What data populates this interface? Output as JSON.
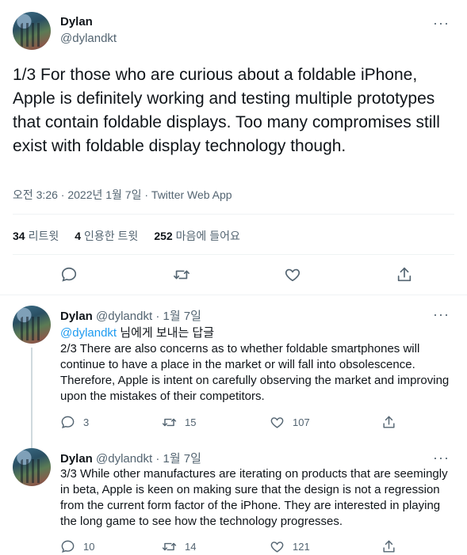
{
  "main_tweet": {
    "name": "Dylan",
    "handle": "@dylandkt",
    "text": "1/3 For those who are curious about a foldable iPhone, Apple is definitely working and testing multiple prototypes that contain foldable displays. Too many compromises still exist with foldable display technology though.",
    "meta": "오전 3:26 · 2022년 1월 7일 · Twitter Web App",
    "stats": {
      "retweets_count": "34",
      "retweets_label": "리트윗",
      "quotes_count": "4",
      "quotes_label": "인용한 트윗",
      "likes_count": "252",
      "likes_label": "마음에 들어요"
    }
  },
  "replies": [
    {
      "name": "Dylan",
      "handle": "@dylandkt",
      "date": "· 1월 7일",
      "reply_mention": "@dylandkt",
      "reply_suffix": "님에게 보내는 답글",
      "text": "2/3 There are also concerns as to whether foldable smartphones will continue to have a place in the market or will fall into obsolescence. Therefore, Apple is intent on carefully observing the market and improving upon the mistakes of their competitors.",
      "replies_count": "3",
      "retweets_count": "15",
      "likes_count": "107"
    },
    {
      "name": "Dylan",
      "handle": "@dylandkt",
      "date": "· 1월 7일",
      "text": "3/3 While other manufactures are iterating on products that are seemingly in beta, Apple is keen on making sure that the design is not a regression from the current form factor of the iPhone. They are interested in playing the long game to see how the technology progresses.",
      "replies_count": "10",
      "retweets_count": "14",
      "likes_count": "121"
    }
  ],
  "colors": {
    "accent": "#1d9bf0",
    "text": "#0f1419",
    "secondary": "#536471",
    "divider": "#eff3f4"
  }
}
